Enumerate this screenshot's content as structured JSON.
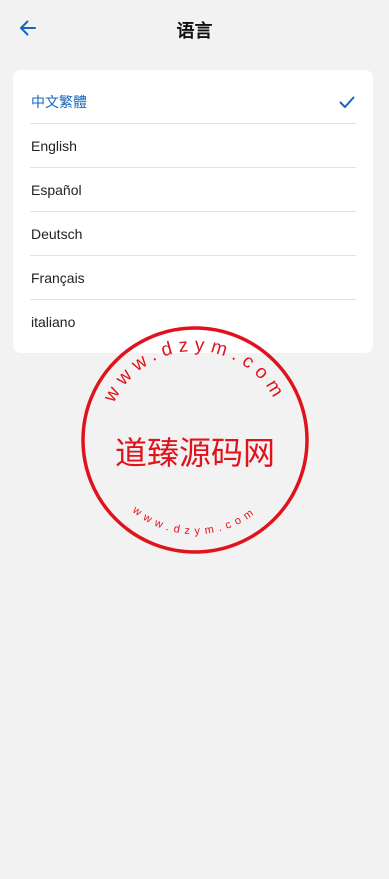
{
  "header": {
    "title": "语言"
  },
  "languages": [
    {
      "label": "中文繁體",
      "selected": true
    },
    {
      "label": "English",
      "selected": false
    },
    {
      "label": "Español",
      "selected": false
    },
    {
      "label": "Deutsch",
      "selected": false
    },
    {
      "label": "Français",
      "selected": false
    },
    {
      "label": "italiano",
      "selected": false
    }
  ],
  "watermark": {
    "main_text": "道臻源码网",
    "ring_top": "www.dzym.com",
    "ring_bottom": "www.dzym.com",
    "color": "#e0131c"
  },
  "colors": {
    "accent": "#1565c0",
    "background": "#f2f2f2",
    "card": "#ffffff"
  },
  "icons": {
    "back": "arrow-left-icon",
    "check": "check-icon"
  }
}
